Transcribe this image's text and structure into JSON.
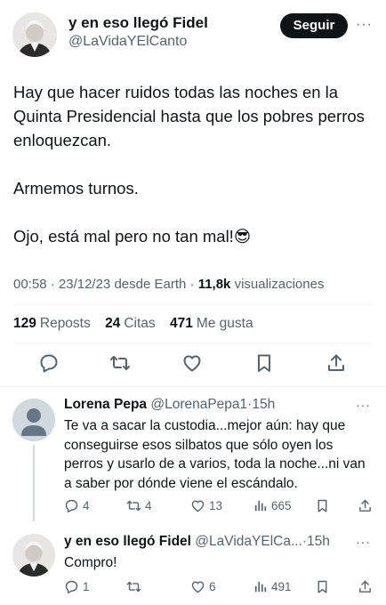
{
  "tweet": {
    "author_name": "y en eso llegó Fidel",
    "author_handle": "@LaVidaYElCanto",
    "follow_label": "Seguir",
    "more_icon": "more-dots-icon",
    "paragraphs": [
      "Hay que hacer ruidos todas las noches en la Quinta Presidencial hasta que los pobres perros enloquezcan.",
      "Armemos turnos.",
      "Ojo,  está mal  pero no tan mal!😎"
    ],
    "meta": {
      "time": "00:58",
      "date": "23/12/23",
      "source": "desde Earth",
      "views": "11,8k",
      "views_label": "visualizaciones"
    },
    "stats": {
      "reposts": "129",
      "reposts_label": "Reposts",
      "quotes": "24",
      "quotes_label": "Citas",
      "likes": "471",
      "likes_label": "Me gusta"
    }
  },
  "replies": [
    {
      "name": "Lorena Pepa",
      "handle": "@LorenaPepa1",
      "time": "15h",
      "text": "Te va a sacar la custodia...mejor aún: hay que conseguirse esos silbatos que sólo oyen los perros y usarlo de a varios, toda la noche...ni van a saber por dónde viene el escándalo.",
      "replies": "4",
      "reposts": "4",
      "likes": "13",
      "views": "665"
    },
    {
      "name": "y en eso llegó Fidel",
      "handle": "@LaVidaYElCa...",
      "time": "15h",
      "text": "Compro!",
      "replies": "1",
      "reposts": "",
      "likes": "6",
      "views": "491"
    }
  ],
  "separator": "·",
  "colors": {
    "text": "#0f1419",
    "secondary": "#536471",
    "divider": "#eff3f4",
    "button_bg": "#0f1419"
  }
}
